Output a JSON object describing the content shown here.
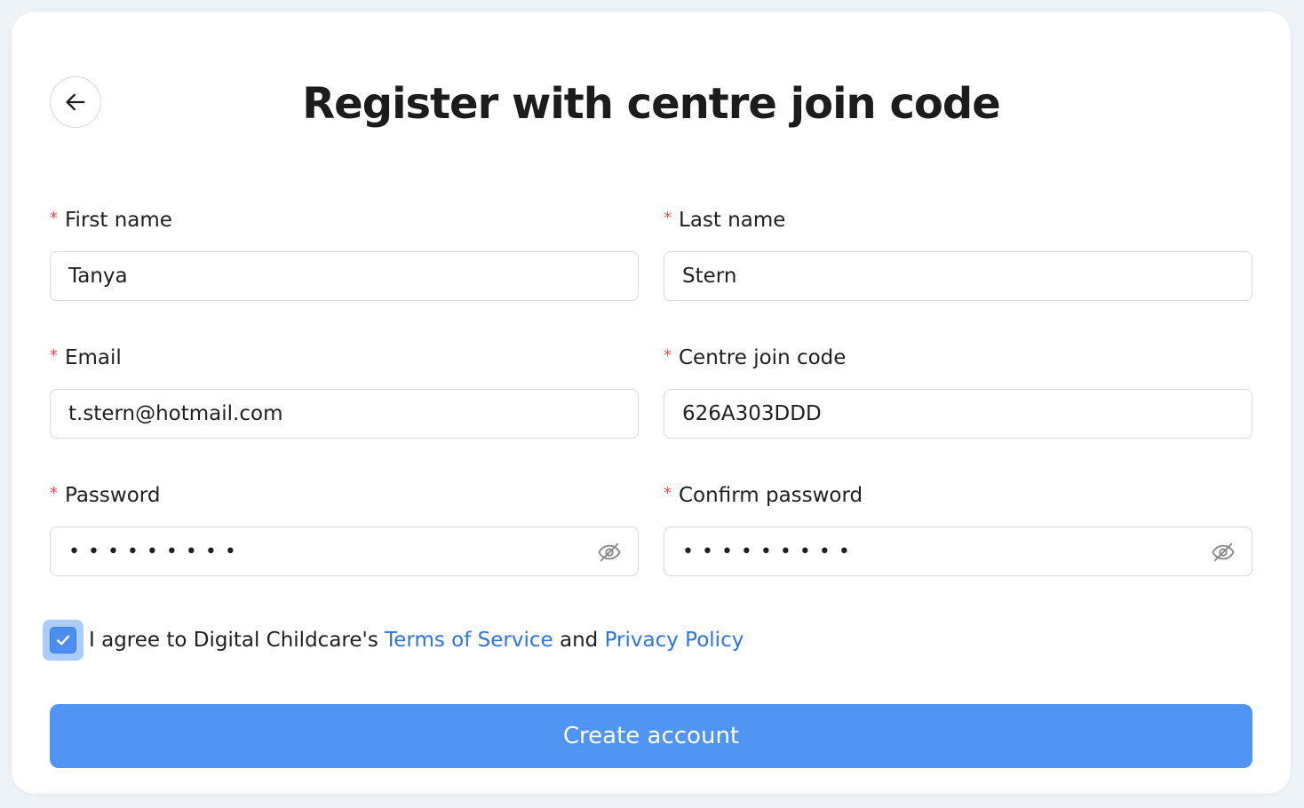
{
  "page": {
    "title": "Register with centre join code"
  },
  "form": {
    "first_name": {
      "label": "First name",
      "value": "Tanya"
    },
    "last_name": {
      "label": "Last name",
      "value": "Stern"
    },
    "email": {
      "label": "Email",
      "value": "t.stern@hotmail.com"
    },
    "join_code": {
      "label": "Centre join code",
      "value": "626A303DDD"
    },
    "password": {
      "label": "Password",
      "masked": "•••••••••"
    },
    "confirm_password": {
      "label": "Confirm password",
      "masked": "•••••••••"
    },
    "required_marker": "*"
  },
  "agreement": {
    "checked": true,
    "prefix": "I agree to Digital Childcare's ",
    "terms_link": "Terms of Service",
    "and": " and ",
    "privacy_link": "Privacy Policy"
  },
  "actions": {
    "create_label": "Create account"
  },
  "colors": {
    "accent": "#5095f3",
    "link": "#2f74e6",
    "required": "#ff4d4f"
  },
  "icons": {
    "back": "arrow-left-icon",
    "password_toggle": "eye-off-icon",
    "checkbox": "check-icon"
  }
}
